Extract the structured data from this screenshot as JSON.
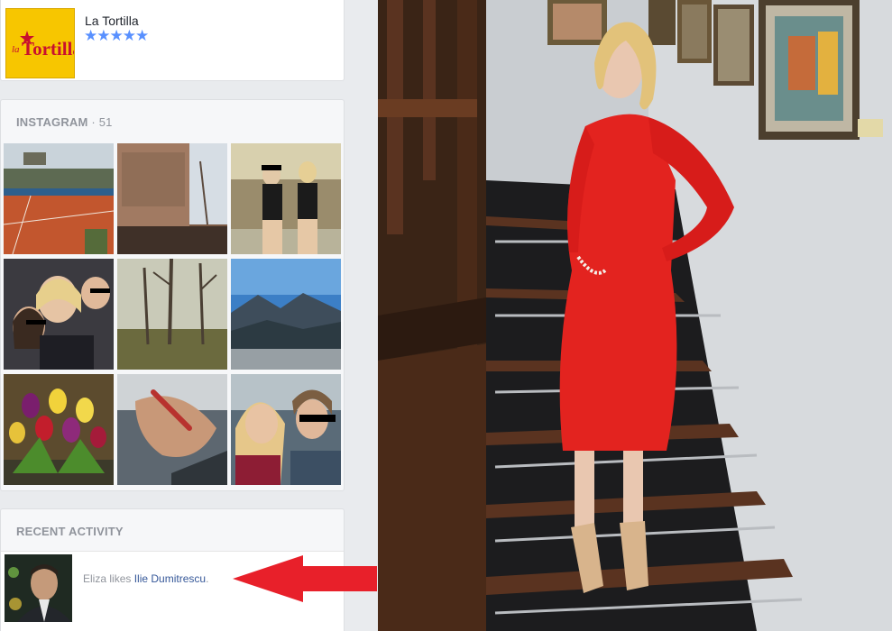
{
  "place": {
    "logo_text": "laTortilla",
    "name": "La Tortilla",
    "stars": "★★★★★",
    "rating": 5
  },
  "instagram": {
    "title": "INSTAGRAM",
    "separator": "·",
    "count": "51",
    "photos": [
      "tennis-stadium-photo",
      "painted-church-wall-photo",
      "two-women-on-sofa-photo",
      "group-selfie-photo",
      "bare-trees-park-photo",
      "mountain-landscape-photo",
      "tulips-bouquet-photo",
      "holding-hands-photo",
      "two-women-selfie-photo"
    ]
  },
  "recent": {
    "title": "RECENT ACTIVITY",
    "actor": "Eliza",
    "verb": "likes",
    "target": "Ilie Dumitrescu",
    "period": "."
  },
  "colors": {
    "accent_blue": "#5890ff",
    "link_blue": "#365899",
    "arrow_red": "#e8202a",
    "dress_red": "#e3231f"
  }
}
